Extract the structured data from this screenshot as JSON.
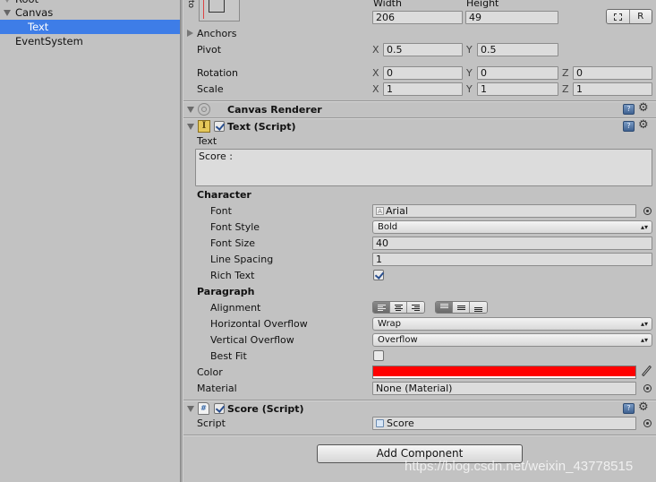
{
  "hierarchy": {
    "items": [
      {
        "label": "Root",
        "indent": 0,
        "expanded": false
      },
      {
        "label": "Canvas",
        "indent": 1,
        "expanded": true
      },
      {
        "label": "Text",
        "indent": 2,
        "selected": true
      },
      {
        "label": "EventSystem",
        "indent": 1
      }
    ]
  },
  "rect_transform": {
    "anchor_preset_side_label": "to",
    "width_label": "Width",
    "height_label": "Height",
    "width": "206",
    "height": "49",
    "blueprint_button": "⬚",
    "raw_button": "R",
    "anchors_label": "Anchors",
    "pivot_label": "Pivot",
    "pivot": {
      "x": "0.5",
      "y": "0.5"
    },
    "rotation_label": "Rotation",
    "rotation": {
      "x": "0",
      "y": "0",
      "z": "0"
    },
    "scale_label": "Scale",
    "scale": {
      "x": "1",
      "y": "1",
      "z": "1"
    },
    "axis_x": "X",
    "axis_y": "Y",
    "axis_z": "Z"
  },
  "canvas_renderer": {
    "title": "Canvas Renderer"
  },
  "text_script": {
    "title": "Text (Script)",
    "enabled": true,
    "text_label": "Text",
    "text_value": "Score :",
    "character_header": "Character",
    "font_label": "Font",
    "font_value": "Arial",
    "font_style_label": "Font Style",
    "font_style_value": "Bold",
    "font_size_label": "Font Size",
    "font_size_value": "40",
    "line_spacing_label": "Line Spacing",
    "line_spacing_value": "1",
    "rich_text_label": "Rich Text",
    "rich_text": true,
    "paragraph_header": "Paragraph",
    "alignment_label": "Alignment",
    "alignment_horizontal": "left",
    "alignment_vertical": "top",
    "horizontal_overflow_label": "Horizontal Overflow",
    "horizontal_overflow_value": "Wrap",
    "vertical_overflow_label": "Vertical Overflow",
    "vertical_overflow_value": "Overflow",
    "best_fit_label": "Best Fit",
    "best_fit": false,
    "color_label": "Color",
    "color_value": "#ff0000",
    "material_label": "Material",
    "material_value": "None (Material)"
  },
  "score_script": {
    "title": "Score (Script)",
    "enabled": true,
    "script_label": "Script",
    "script_value": "Score"
  },
  "add_component_label": "Add Component",
  "watermark": "https://blog.csdn.net/weixin_43778515",
  "icons": {
    "help": "?",
    "gear": "⚙",
    "dropdown_arrow": "▴▾"
  },
  "colors": {
    "selection": "#3e7de7",
    "panel_bg": "#c2c2c2",
    "color_swatch": "#ff0000"
  }
}
